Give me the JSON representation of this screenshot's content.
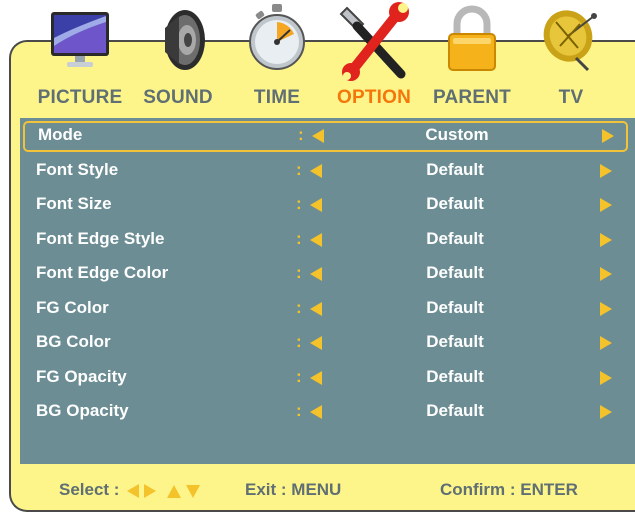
{
  "tabs": [
    {
      "label": "PICTURE",
      "icon": "monitor-icon"
    },
    {
      "label": "SOUND",
      "icon": "speaker-icon"
    },
    {
      "label": "TIME",
      "icon": "stopwatch-icon"
    },
    {
      "label": "OPTION",
      "icon": "tools-icon",
      "active": true
    },
    {
      "label": "PARENT",
      "icon": "padlock-icon"
    },
    {
      "label": "TV",
      "icon": "satellite-dish-icon"
    }
  ],
  "rows": [
    {
      "name": "Mode",
      "sep": ":",
      "value": "Custom",
      "selected": true
    },
    {
      "name": "Font Style",
      "sep": ":",
      "value": "Default"
    },
    {
      "name": "Font Size",
      "sep": ":",
      "value": "Default"
    },
    {
      "name": "Font Edge Style",
      "sep": ":",
      "value": "Default"
    },
    {
      "name": "Font Edge Color",
      "sep": ":",
      "value": "Default"
    },
    {
      "name": "FG Color",
      "sep": ":",
      "value": "Default"
    },
    {
      "name": "BG Color",
      "sep": ":",
      "value": "Default"
    },
    {
      "name": "FG Opacity",
      "sep": ":",
      "value": "Default"
    },
    {
      "name": "BG Opacity",
      "sep": ":",
      "value": "Default"
    }
  ],
  "footer": {
    "select_label": "Select :",
    "exit_label": "Exit : MENU",
    "confirm_label": "Confirm : ENTER"
  },
  "colors": {
    "frame_bg": "#fdf58a",
    "panel_bg": "#6b8d93",
    "active_tab": "#f5760a",
    "tab_text": "#5f6f73",
    "arrow": "#f4c22a",
    "selection_border": "#f2c238"
  }
}
